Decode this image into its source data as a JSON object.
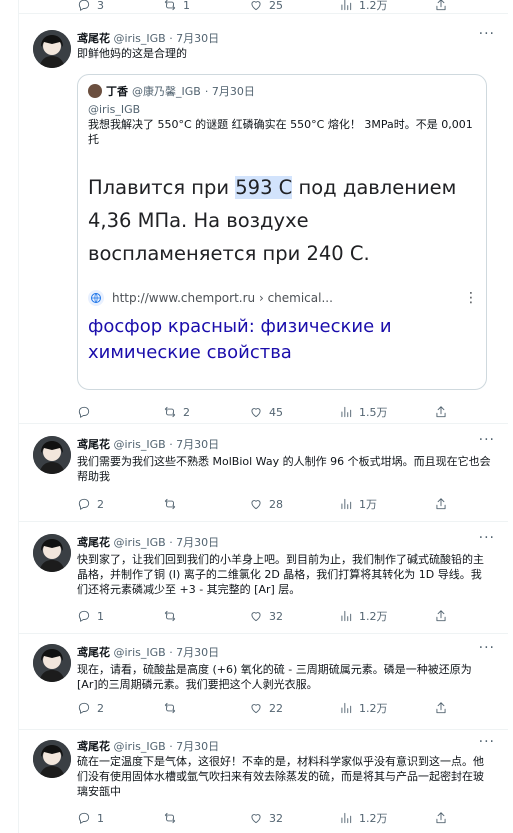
{
  "icons": {
    "reply": "reply-icon",
    "retweet": "retweet-icon",
    "like": "heart-icon",
    "views": "views-icon",
    "share": "share-icon",
    "more": "more-icon"
  },
  "top_actions": {
    "replies": "3",
    "retweets": "1",
    "likes": "25",
    "views": "1.2万"
  },
  "tweets": [
    {
      "name": "鸢尾花",
      "handle": "@iris_IGB",
      "date": "· 7月30日",
      "text": "即鲜他妈的这是合理的",
      "quote": {
        "name": "丁香",
        "handle": "@康乃馨_IGB",
        "date": "· 7月30日",
        "sub1": "@iris_IGB",
        "sub2": "我想我解决了 550°C 的谜题 红磷确实在 550°C 熔化！ 3MPa时。不是 0,001 托",
        "ru_prefix": "Плавится при ",
        "ru_highlight": "593 С",
        "ru_suffix": " под давлением 4,36 МПа. На воздухе воспламеняется при 240 С.",
        "link_url": "http://www.chemport.ru › chemical...",
        "link_title": "фосфор красный: физические и химические свойства"
      },
      "actions": {
        "replies": "",
        "retweets": "2",
        "likes": "45",
        "views": "1.5万"
      }
    },
    {
      "name": "鸢尾花",
      "handle": "@iris_IGB",
      "date": "· 7月30日",
      "text": "我们需要为我们这些不熟悉 MolBiol Way 的人制作 96 个板式坩埚。而且现在它也会帮助我",
      "actions": {
        "replies": "2",
        "retweets": "",
        "likes": "28",
        "views": "1万"
      }
    },
    {
      "name": "鸢尾花",
      "handle": "@iris_IGB",
      "date": "· 7月30日",
      "text": "快到家了，让我们回到我们的小羊身上吧。到目前为止，我们制作了碱式硫酸铅的主晶格，并制作了铜 (I) 离子的二维氯化 2D 晶格，我们打算将其转化为 1D 导线。我们还将元素磷减少至 +3 - 其完整的 [Ar] 层。",
      "actions": {
        "replies": "1",
        "retweets": "",
        "likes": "32",
        "views": "1.2万"
      }
    },
    {
      "name": "鸢尾花",
      "handle": "@iris_IGB",
      "date": "· 7月30日",
      "text": "现在，请看，硫酸盐是高度 (+6) 氧化的硫 - 三周期硫属元素。磷是一种被还原为[Ar]的三周期磷元素。我们要把这个人剥光衣服。",
      "actions": {
        "replies": "2",
        "retweets": "",
        "likes": "22",
        "views": "1.2万"
      }
    },
    {
      "name": "鸢尾花",
      "handle": "@iris_IGB",
      "date": "· 7月30日",
      "text": "硫在一定温度下是气体，这很好！不幸的是，材料科学家似乎没有意识到这一点。他们没有使用固体水槽或氩气吹扫来有效去除蒸发的硫，而是将其与产品一起密封在玻璃安瓿中",
      "actions": {
        "replies": "1",
        "retweets": "",
        "likes": "32",
        "views": "1.2万"
      }
    }
  ]
}
